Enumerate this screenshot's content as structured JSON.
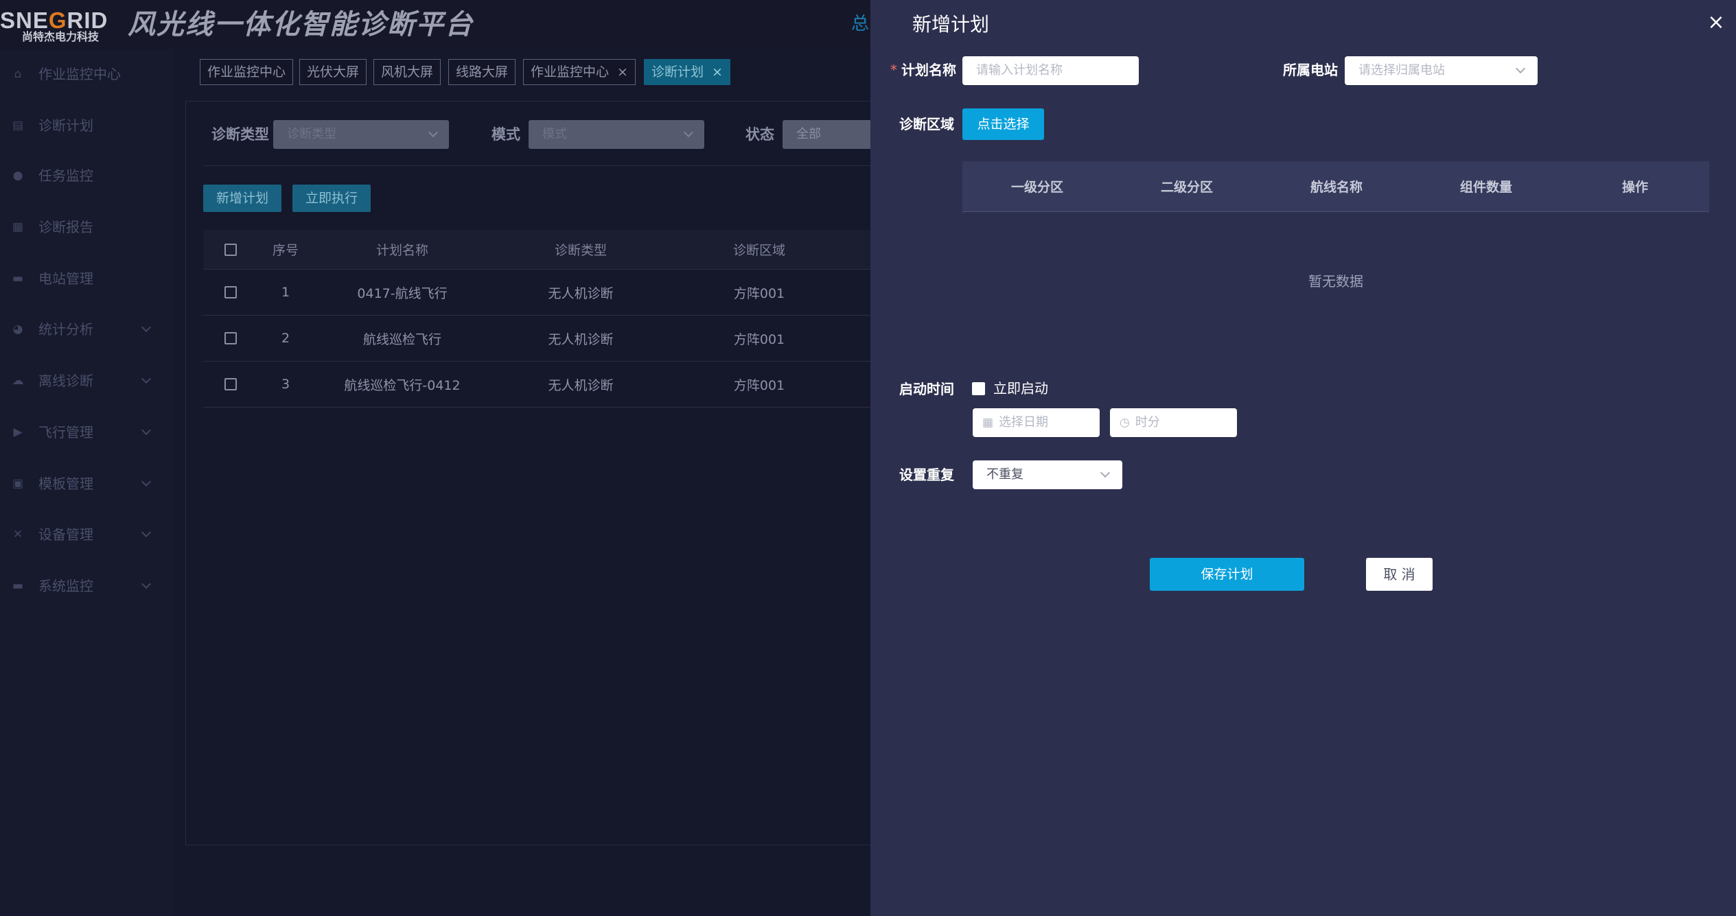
{
  "header": {
    "logo_text_pre": "SNE",
    "logo_text_g": "G",
    "logo_text_post": "RID",
    "logo_subtitle": "尚特杰电力科技",
    "platform_title": "风光线一体化智能诊断平台",
    "right_text": "总"
  },
  "sidebar": {
    "items": [
      {
        "label": "作业监控中心",
        "icon": "home-icon"
      },
      {
        "label": "诊断计划",
        "icon": "plan-icon"
      },
      {
        "label": "任务监控",
        "icon": "monitor-icon"
      },
      {
        "label": "诊断报告",
        "icon": "report-icon"
      },
      {
        "label": "电站管理",
        "icon": "station-icon"
      },
      {
        "label": "统计分析",
        "icon": "pie-chart-icon"
      },
      {
        "label": "离线诊断",
        "icon": "offline-icon"
      },
      {
        "label": "飞行管理",
        "icon": "flight-icon"
      },
      {
        "label": "模板管理",
        "icon": "template-icon"
      },
      {
        "label": "设备管理",
        "icon": "tools-icon"
      },
      {
        "label": "系统监控",
        "icon": "system-icon"
      }
    ]
  },
  "tags": [
    {
      "label": "作业监控中心"
    },
    {
      "label": "光伏大屏"
    },
    {
      "label": "风机大屏"
    },
    {
      "label": "线路大屏"
    },
    {
      "label": "作业监控中心",
      "close": "×"
    },
    {
      "label": "诊断计划",
      "close": "×"
    }
  ],
  "filters": {
    "type_label": "诊断类型",
    "type_placeholder": "诊断类型",
    "mode_label": "模式",
    "mode_placeholder": "模式",
    "status_label": "状态",
    "status_value": "全部"
  },
  "actions": {
    "add_plan": "新增计划",
    "execute_now": "立即执行"
  },
  "plan_table": {
    "headers": [
      "序号",
      "计划名称",
      "诊断类型",
      "诊断区域"
    ],
    "rows": [
      [
        "1",
        "0417-航线飞行",
        "无人机诊断",
        "方阵001"
      ],
      [
        "2",
        "航线巡检飞行",
        "无人机诊断",
        "方阵001"
      ],
      [
        "3",
        "航线巡检飞行-0412",
        "无人机诊断",
        "方阵001"
      ]
    ]
  },
  "drawer": {
    "title": "新增计划",
    "close_symbol": "×",
    "required_mark": "*",
    "plan_name_label": "计划名称",
    "plan_name_placeholder": "请输入计划名称",
    "station_label": "所属电站",
    "station_placeholder": "请选择归属电站",
    "area_label": "诊断区域",
    "select_button": "点击选择",
    "area_headers": [
      "一级分区",
      "二级分区",
      "航线名称",
      "组件数量",
      "操作"
    ],
    "empty_text": "暂无数据",
    "start_label": "启动时间",
    "start_now_label": "立即启动",
    "date_placeholder": "选择日期",
    "time_placeholder": "时分",
    "repeat_label": "设置重复",
    "repeat_value": "不重复",
    "save_button": "保存计划",
    "cancel_button": "取 消"
  },
  "colors": {
    "accent": "#0aa2dc",
    "drawer_bg": "#2d2f4e",
    "page_bg": "#15172b",
    "required": "#f56c6c"
  }
}
